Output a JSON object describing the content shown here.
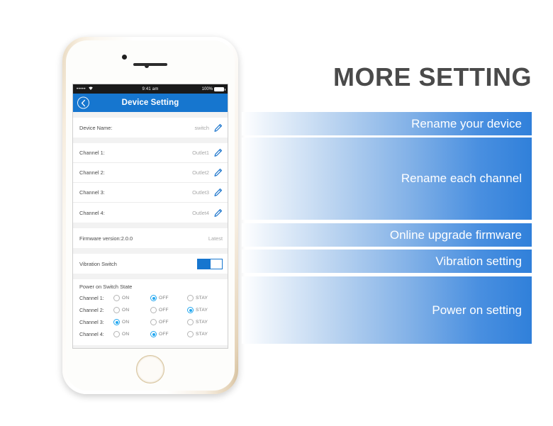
{
  "heading": "MORE SETTING",
  "phone": {
    "statusbar": {
      "signal_dots": "•••••",
      "wifi_icon": "wifi-icon",
      "time": "9:41 am",
      "battery_percent": "100%",
      "battery_icon": "battery-full-icon"
    },
    "navbar": {
      "back_icon": "chevron-left-icon",
      "title": "Device Setting"
    },
    "settings": {
      "device_name": {
        "label": "Device Name:",
        "value": "switch",
        "edit_icon": "pencil-icon"
      },
      "channels": [
        {
          "label": "Channel 1:",
          "value": "Outlet1",
          "edit_icon": "pencil-icon"
        },
        {
          "label": "Channel 2:",
          "value": "Outlet2",
          "edit_icon": "pencil-icon"
        },
        {
          "label": "Channel 3:",
          "value": "Outlet3",
          "edit_icon": "pencil-icon"
        },
        {
          "label": "Channel 4:",
          "value": "Outlet4",
          "edit_icon": "pencil-icon"
        }
      ],
      "firmware": {
        "label": "Firmware version:2.0.0",
        "value": "Latest"
      },
      "vibration": {
        "label": "Vibration Switch",
        "state": "on"
      },
      "power_on": {
        "title": "Power on Switch State",
        "options": [
          "ON",
          "OFF",
          "STAY"
        ],
        "rows": [
          {
            "label": "Channel 1:",
            "selected": "OFF"
          },
          {
            "label": "Channel 2:",
            "selected": "STAY"
          },
          {
            "label": "Channel 3:",
            "selected": "ON"
          },
          {
            "label": "Channel 4:",
            "selected": "OFF"
          }
        ]
      }
    }
  },
  "feature_bars": [
    {
      "label": "Rename your device"
    },
    {
      "label": "Rename each channel"
    },
    {
      "label": "Online upgrade firmware"
    },
    {
      "label": "Vibration setting"
    },
    {
      "label": "Power on setting"
    }
  ],
  "colors": {
    "brand_blue": "#1676cf",
    "radio_blue": "#22a7f0",
    "heading_gray": "#4a4a4a",
    "bar_blue": "#3080da"
  }
}
